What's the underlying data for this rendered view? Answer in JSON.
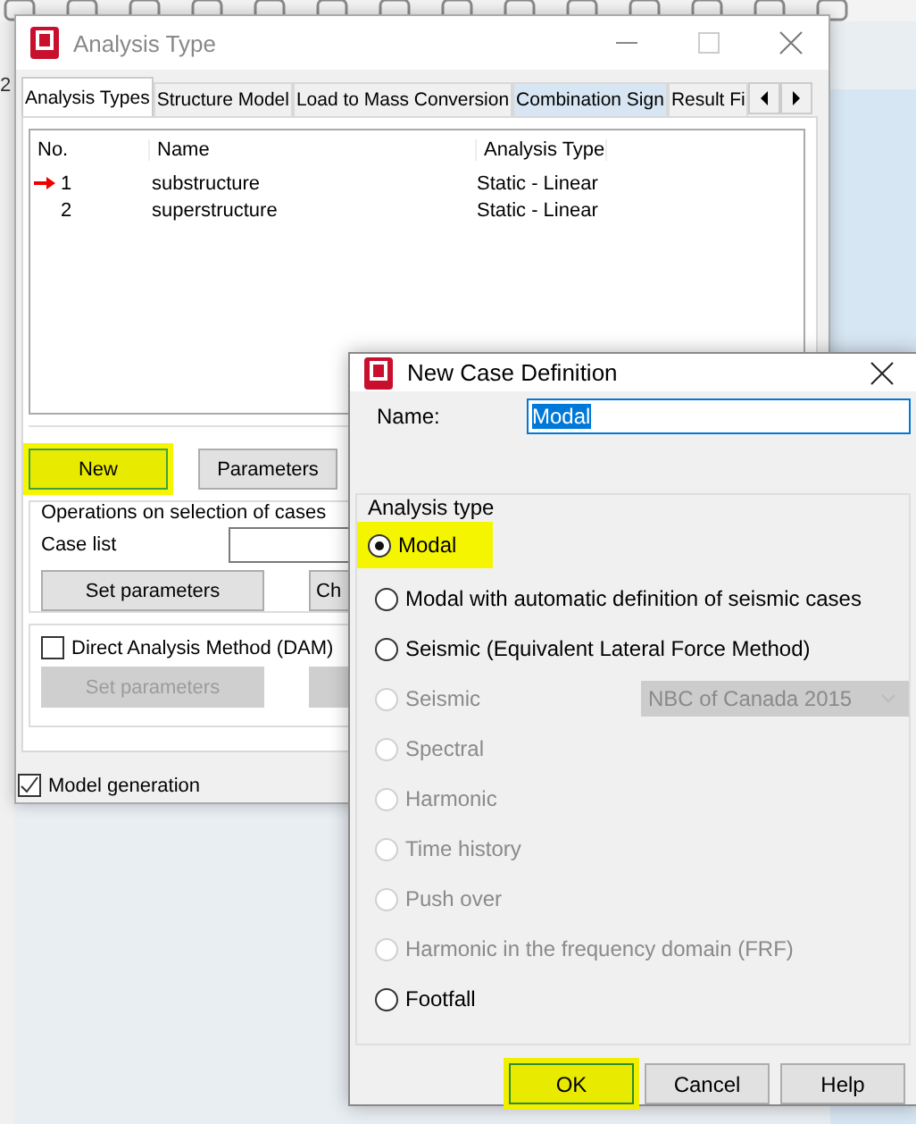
{
  "background_app": {
    "side_label": "2"
  },
  "analysis_window": {
    "title": "Analysis Type",
    "tabs": [
      {
        "label": "Analysis Types",
        "selected": true
      },
      {
        "label": "Structure Model",
        "selected": false
      },
      {
        "label": "Load to Mass Conversion",
        "selected": false
      },
      {
        "label": "Combination Sign",
        "selected": false
      },
      {
        "label": "Result Fi",
        "selected": false
      }
    ],
    "table": {
      "columns": [
        "No.",
        "Name",
        "Analysis Type"
      ],
      "rows": [
        {
          "no": "1",
          "name": "substructure",
          "type": "Static - Linear",
          "current": true
        },
        {
          "no": "2",
          "name": "superstructure",
          "type": "Static - Linear",
          "current": false
        }
      ]
    },
    "buttons": [
      {
        "label": "New",
        "highlighted": true
      },
      {
        "label": "Parameters",
        "highlighted": false
      }
    ],
    "operations": {
      "title": "Operations on selection of cases",
      "case_list_label": "Case list",
      "buttons": [
        {
          "label": "Set parameters"
        },
        {
          "label": "Ch"
        }
      ]
    },
    "dam": {
      "label": "Direct Analysis Method (DAM)",
      "checked": false,
      "buttons": [
        {
          "label": "Set parameters",
          "disabled": true
        },
        {
          "disabled": true
        }
      ]
    },
    "model_generation": {
      "label": "Model generation",
      "checked": true
    }
  },
  "new_case_dialog": {
    "title": "New Case Definition",
    "name_label": "Name:",
    "name_value": "Modal",
    "name_value_selected": true,
    "group_title": "Analysis type",
    "options": [
      {
        "kind": "radio",
        "label": "Modal",
        "selected": true,
        "disabled": false,
        "highlighted": true
      },
      {
        "kind": "radio",
        "label": "Modal with automatic definition of seismic cases",
        "selected": false,
        "disabled": false,
        "highlighted": false
      },
      {
        "kind": "radio",
        "label": "Seismic (Equivalent Lateral Force Method)",
        "selected": false,
        "disabled": false,
        "highlighted": false
      },
      {
        "kind": "radio_dropdown",
        "label": "Seismic",
        "selected": false,
        "disabled": true,
        "highlighted": false,
        "dropdown": "NBC of Canada 2015"
      },
      {
        "kind": "radio",
        "label": "Spectral",
        "selected": false,
        "disabled": true,
        "highlighted": false
      },
      {
        "kind": "radio",
        "label": "Harmonic",
        "selected": false,
        "disabled": true,
        "highlighted": false
      },
      {
        "kind": "radio",
        "label": "Time history",
        "selected": false,
        "disabled": true,
        "highlighted": false
      },
      {
        "kind": "radio",
        "label": "Push over",
        "selected": false,
        "disabled": true,
        "highlighted": false
      },
      {
        "kind": "radio",
        "label": "Harmonic in the frequency domain (FRF)",
        "selected": false,
        "disabled": true,
        "highlighted": false
      },
      {
        "kind": "radio",
        "label": "Footfall",
        "selected": false,
        "disabled": false,
        "highlighted": false
      }
    ],
    "buttons": [
      {
        "label": "OK",
        "highlighted": true
      },
      {
        "label": "Cancel",
        "highlighted": false
      },
      {
        "label": "Help",
        "highlighted": false
      }
    ]
  }
}
